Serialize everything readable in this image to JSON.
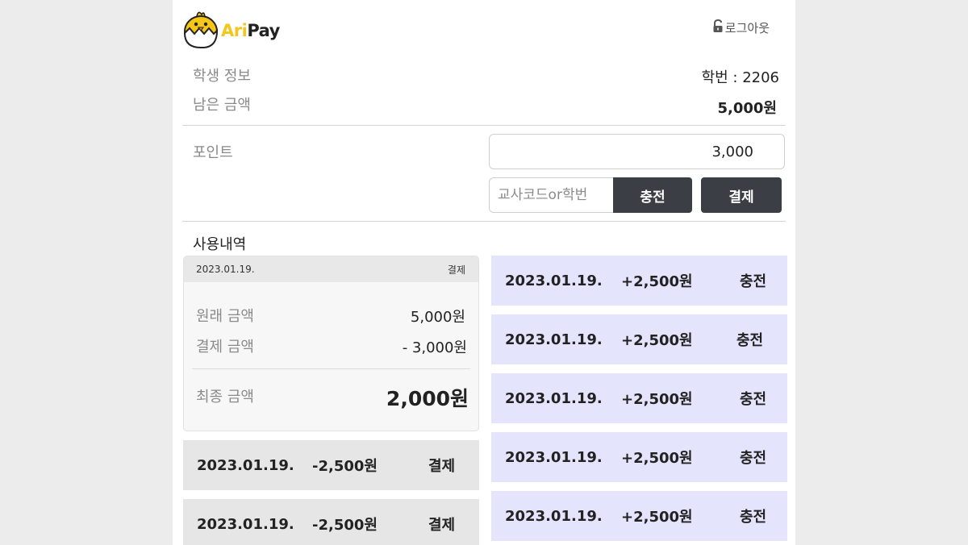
{
  "header": {
    "logo_icon": "chick-icon",
    "logo_ari": "Ari",
    "logo_pay": "Pay",
    "logout_icon": "unlock-icon",
    "logout_label": "로그아웃"
  },
  "student": {
    "info_label": "학생 정보",
    "id_text": "학번 : 2206",
    "balance_label": "남은 금액",
    "balance_value": "5,000원"
  },
  "points": {
    "label": "포인트",
    "value": "3,000",
    "code_placeholder": "교사코드or학번",
    "charge_button": "충전",
    "pay_button": "결제"
  },
  "history": {
    "title": "사용내역",
    "detail": {
      "date": "2023.01.19.",
      "type": "결제",
      "original_label": "원래 금액",
      "original_value": "5,000원",
      "payment_label": "결제 금액",
      "payment_value": "- 3,000원",
      "final_label": "최종 금액",
      "final_value": "2,000원"
    },
    "left_rows": [
      {
        "date": "2023.01.19.",
        "amount": "-2,500원",
        "type": "결제"
      },
      {
        "date": "2023.01.19.",
        "amount": "-2,500원",
        "type": "결제"
      }
    ],
    "right_rows": [
      {
        "date": "2023.01.19.",
        "amount": "+2,500원",
        "type": "충전"
      },
      {
        "date": "2023.01.19.",
        "amount": "+2,500원",
        "type": "충전"
      },
      {
        "date": "2023.01.19.",
        "amount": "+2,500원",
        "type": "충전"
      },
      {
        "date": "2023.01.19.",
        "amount": "+2,500원",
        "type": "충전"
      },
      {
        "date": "2023.01.19.",
        "amount": "+2,500원",
        "type": "충전"
      }
    ]
  },
  "colors": {
    "brand_yellow": "#f5c518",
    "button_dark": "#3b3f45",
    "charge_row_bg": "#e4e5fd",
    "pay_row_bg": "#e6e6e6"
  }
}
